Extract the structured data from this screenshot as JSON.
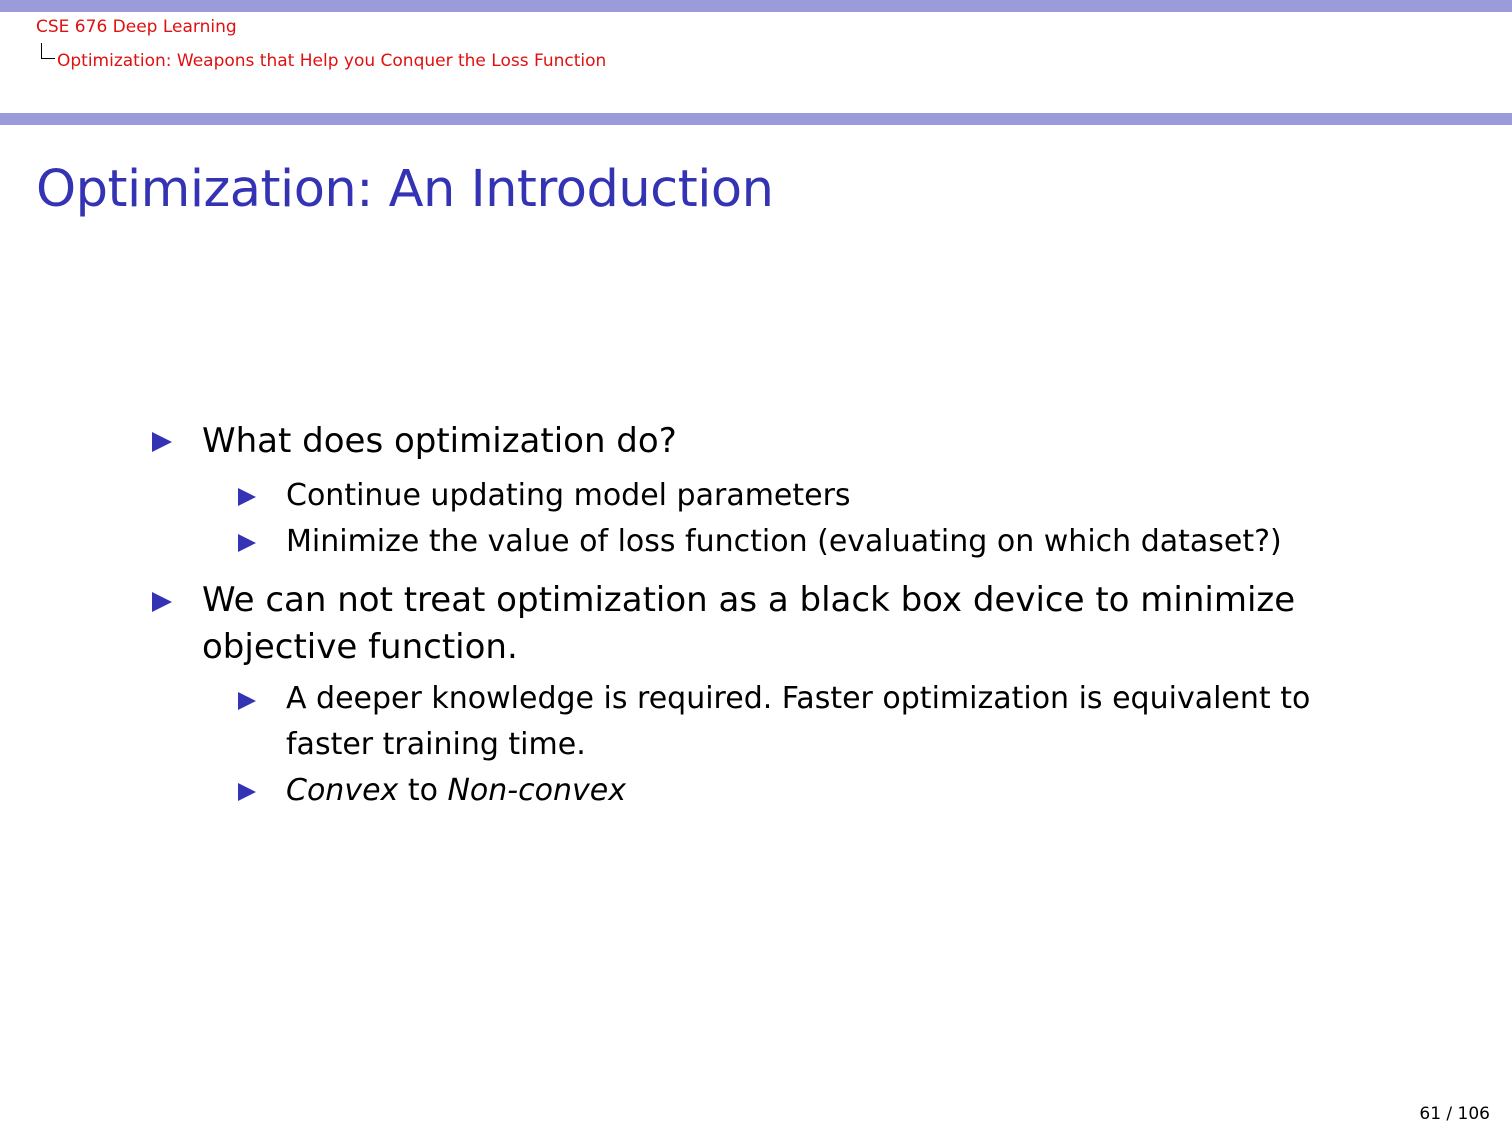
{
  "header": {
    "course": "CSE 676 Deep Learning",
    "section": "Optimization: Weapons that Help you Conquer the Loss Function"
  },
  "slide": {
    "title": "Optimization: An Introduction",
    "bullets": [
      {
        "text": "What does optimization do?",
        "sub": [
          "Continue updating model parameters",
          "Minimize the value of loss function (evaluating on which dataset?)"
        ]
      },
      {
        "text_line1": "We can not treat optimization as a black box device to minimize",
        "text_line2": "objective function.",
        "sub": [
          {
            "line1": "A deeper knowledge is required. Faster optimization is equivalent to",
            "line2": "faster training time."
          },
          {
            "part1": "Convex",
            "part2": " to ",
            "part3": "Non-convex"
          }
        ]
      }
    ]
  },
  "footer": {
    "page": "61 / 106"
  },
  "colors": {
    "bar": "#9b9bdc",
    "title": "#3333b3",
    "header_text": "#e01010",
    "bullet": "#3333b3"
  },
  "icons": {
    "bullet": "triangle-right-icon"
  }
}
